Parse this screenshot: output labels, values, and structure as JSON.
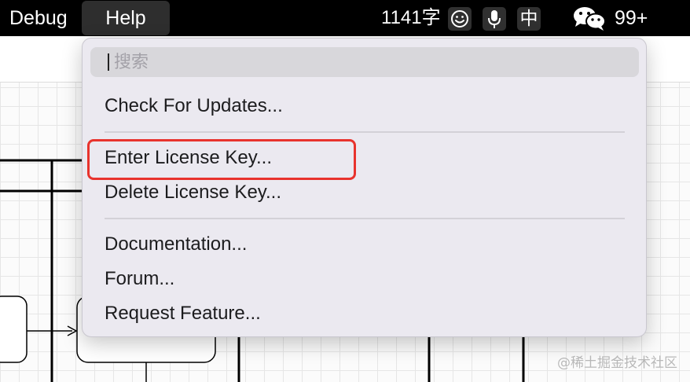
{
  "menubar": {
    "debug_label": "Debug",
    "help_label": "Help",
    "word_count": "1141字",
    "ime_label": "中",
    "badge_count": "99+"
  },
  "icons": [
    "emoji-icon",
    "microphone-icon",
    "wechat-icon"
  ],
  "help_menu": {
    "search_placeholder": "搜索",
    "items": [
      {
        "label": "Check For Updates..."
      },
      {
        "label": "Enter License Key..."
      },
      {
        "label": "Delete License Key..."
      },
      {
        "label": "Documentation..."
      },
      {
        "label": "Forum..."
      },
      {
        "label": "Request Feature..."
      }
    ],
    "highlight_color": "#e8332d"
  },
  "watermark": "@稀土掘金技术社区"
}
